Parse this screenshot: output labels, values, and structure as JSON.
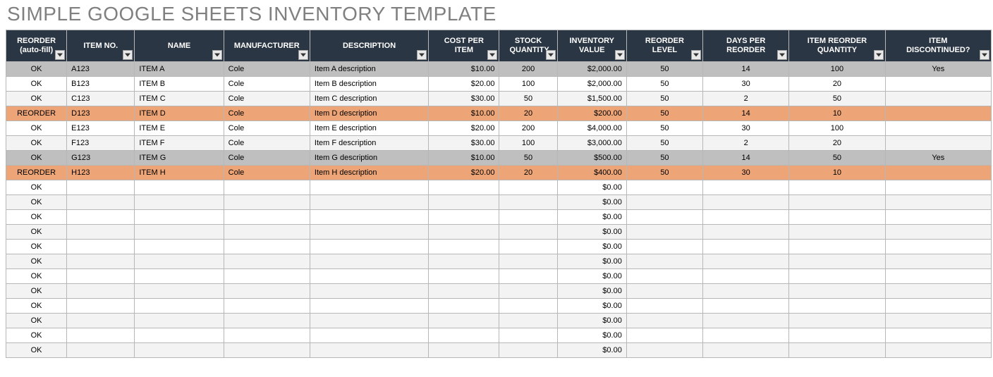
{
  "title": "SIMPLE GOOGLE SHEETS INVENTORY TEMPLATE",
  "columns": [
    {
      "key": "reorder",
      "label": "REORDER\n(auto-fill)",
      "align": "c"
    },
    {
      "key": "item_no",
      "label": "ITEM NO.",
      "align": "l"
    },
    {
      "key": "name",
      "label": "NAME",
      "align": "l"
    },
    {
      "key": "manufacturer",
      "label": "MANUFACTURER",
      "align": "l"
    },
    {
      "key": "description",
      "label": "DESCRIPTION",
      "align": "l"
    },
    {
      "key": "cost",
      "label": "COST PER ITEM",
      "align": "r"
    },
    {
      "key": "stock",
      "label": "STOCK\nQUANTITY",
      "align": "c"
    },
    {
      "key": "inv_value",
      "label": "INVENTORY\nVALUE",
      "align": "r"
    },
    {
      "key": "reorder_level",
      "label": "REORDER LEVEL",
      "align": "c"
    },
    {
      "key": "days",
      "label": "DAYS PER REORDER",
      "align": "c"
    },
    {
      "key": "reorder_qty",
      "label": "ITEM REORDER\nQUANTITY",
      "align": "c"
    },
    {
      "key": "discontinued",
      "label": "ITEM\nDISCONTINUED?",
      "align": "c"
    }
  ],
  "rows": [
    {
      "state": "disc",
      "reorder": "OK",
      "item_no": "A123",
      "name": "ITEM A",
      "manufacturer": "Cole",
      "description": "Item A description",
      "cost": "$10.00",
      "stock": "200",
      "inv_value": "$2,000.00",
      "reorder_level": "50",
      "days": "14",
      "reorder_qty": "100",
      "discontinued": "Yes"
    },
    {
      "state": "",
      "reorder": "OK",
      "item_no": "B123",
      "name": "ITEM B",
      "manufacturer": "Cole",
      "description": "Item B description",
      "cost": "$20.00",
      "stock": "100",
      "inv_value": "$2,000.00",
      "reorder_level": "50",
      "days": "30",
      "reorder_qty": "20",
      "discontinued": ""
    },
    {
      "state": "alt",
      "reorder": "OK",
      "item_no": "C123",
      "name": "ITEM C",
      "manufacturer": "Cole",
      "description": "Item C description",
      "cost": "$30.00",
      "stock": "50",
      "inv_value": "$1,500.00",
      "reorder_level": "50",
      "days": "2",
      "reorder_qty": "50",
      "discontinued": ""
    },
    {
      "state": "reorder",
      "reorder": "REORDER",
      "item_no": "D123",
      "name": "ITEM D",
      "manufacturer": "Cole",
      "description": "Item D description",
      "cost": "$10.00",
      "stock": "20",
      "inv_value": "$200.00",
      "reorder_level": "50",
      "days": "14",
      "reorder_qty": "10",
      "discontinued": ""
    },
    {
      "state": "",
      "reorder": "OK",
      "item_no": "E123",
      "name": "ITEM E",
      "manufacturer": "Cole",
      "description": "Item E description",
      "cost": "$20.00",
      "stock": "200",
      "inv_value": "$4,000.00",
      "reorder_level": "50",
      "days": "30",
      "reorder_qty": "100",
      "discontinued": ""
    },
    {
      "state": "alt",
      "reorder": "OK",
      "item_no": "F123",
      "name": "ITEM F",
      "manufacturer": "Cole",
      "description": "Item F description",
      "cost": "$30.00",
      "stock": "100",
      "inv_value": "$3,000.00",
      "reorder_level": "50",
      "days": "2",
      "reorder_qty": "20",
      "discontinued": ""
    },
    {
      "state": "disc",
      "reorder": "OK",
      "item_no": "G123",
      "name": "ITEM G",
      "manufacturer": "Cole",
      "description": "Item G description",
      "cost": "$10.00",
      "stock": "50",
      "inv_value": "$500.00",
      "reorder_level": "50",
      "days": "14",
      "reorder_qty": "50",
      "discontinued": "Yes"
    },
    {
      "state": "reorder",
      "reorder": "REORDER",
      "item_no": "H123",
      "name": "ITEM H",
      "manufacturer": "Cole",
      "description": "Item H description",
      "cost": "$20.00",
      "stock": "20",
      "inv_value": "$400.00",
      "reorder_level": "50",
      "days": "30",
      "reorder_qty": "10",
      "discontinued": ""
    },
    {
      "state": "",
      "reorder": "OK",
      "item_no": "",
      "name": "",
      "manufacturer": "",
      "description": "",
      "cost": "",
      "stock": "",
      "inv_value": "$0.00",
      "reorder_level": "",
      "days": "",
      "reorder_qty": "",
      "discontinued": ""
    },
    {
      "state": "alt",
      "reorder": "OK",
      "item_no": "",
      "name": "",
      "manufacturer": "",
      "description": "",
      "cost": "",
      "stock": "",
      "inv_value": "$0.00",
      "reorder_level": "",
      "days": "",
      "reorder_qty": "",
      "discontinued": ""
    },
    {
      "state": "",
      "reorder": "OK",
      "item_no": "",
      "name": "",
      "manufacturer": "",
      "description": "",
      "cost": "",
      "stock": "",
      "inv_value": "$0.00",
      "reorder_level": "",
      "days": "",
      "reorder_qty": "",
      "discontinued": ""
    },
    {
      "state": "alt",
      "reorder": "OK",
      "item_no": "",
      "name": "",
      "manufacturer": "",
      "description": "",
      "cost": "",
      "stock": "",
      "inv_value": "$0.00",
      "reorder_level": "",
      "days": "",
      "reorder_qty": "",
      "discontinued": ""
    },
    {
      "state": "",
      "reorder": "OK",
      "item_no": "",
      "name": "",
      "manufacturer": "",
      "description": "",
      "cost": "",
      "stock": "",
      "inv_value": "$0.00",
      "reorder_level": "",
      "days": "",
      "reorder_qty": "",
      "discontinued": ""
    },
    {
      "state": "alt",
      "reorder": "OK",
      "item_no": "",
      "name": "",
      "manufacturer": "",
      "description": "",
      "cost": "",
      "stock": "",
      "inv_value": "$0.00",
      "reorder_level": "",
      "days": "",
      "reorder_qty": "",
      "discontinued": ""
    },
    {
      "state": "",
      "reorder": "OK",
      "item_no": "",
      "name": "",
      "manufacturer": "",
      "description": "",
      "cost": "",
      "stock": "",
      "inv_value": "$0.00",
      "reorder_level": "",
      "days": "",
      "reorder_qty": "",
      "discontinued": ""
    },
    {
      "state": "alt",
      "reorder": "OK",
      "item_no": "",
      "name": "",
      "manufacturer": "",
      "description": "",
      "cost": "",
      "stock": "",
      "inv_value": "$0.00",
      "reorder_level": "",
      "days": "",
      "reorder_qty": "",
      "discontinued": ""
    },
    {
      "state": "",
      "reorder": "OK",
      "item_no": "",
      "name": "",
      "manufacturer": "",
      "description": "",
      "cost": "",
      "stock": "",
      "inv_value": "$0.00",
      "reorder_level": "",
      "days": "",
      "reorder_qty": "",
      "discontinued": ""
    },
    {
      "state": "alt",
      "reorder": "OK",
      "item_no": "",
      "name": "",
      "manufacturer": "",
      "description": "",
      "cost": "",
      "stock": "",
      "inv_value": "$0.00",
      "reorder_level": "",
      "days": "",
      "reorder_qty": "",
      "discontinued": ""
    },
    {
      "state": "",
      "reorder": "OK",
      "item_no": "",
      "name": "",
      "manufacturer": "",
      "description": "",
      "cost": "",
      "stock": "",
      "inv_value": "$0.00",
      "reorder_level": "",
      "days": "",
      "reorder_qty": "",
      "discontinued": ""
    },
    {
      "state": "alt",
      "reorder": "OK",
      "item_no": "",
      "name": "",
      "manufacturer": "",
      "description": "",
      "cost": "",
      "stock": "",
      "inv_value": "$0.00",
      "reorder_level": "",
      "days": "",
      "reorder_qty": "",
      "discontinued": ""
    }
  ]
}
